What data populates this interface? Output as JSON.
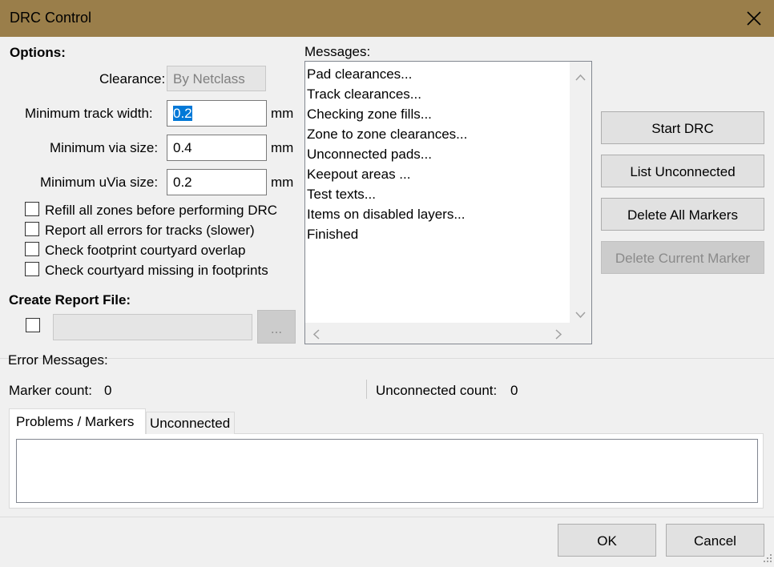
{
  "window": {
    "title": "DRC Control"
  },
  "options": {
    "heading": "Options:",
    "clearance": {
      "label": "Clearance:",
      "value": "By Netclass"
    },
    "min_track": {
      "label": "Minimum track width:",
      "value": "0.2",
      "unit": "mm"
    },
    "min_via": {
      "label": "Minimum via size:",
      "value": "0.4",
      "unit": "mm"
    },
    "min_uvia": {
      "label": "Minimum uVia size:",
      "value": "0.2",
      "unit": "mm"
    },
    "checkboxes": [
      {
        "label": "Refill all zones before performing DRC",
        "checked": false
      },
      {
        "label": "Report all errors for tracks (slower)",
        "checked": false
      },
      {
        "label": "Check footprint courtyard overlap",
        "checked": false
      },
      {
        "label": "Check courtyard missing in footprints",
        "checked": false
      }
    ]
  },
  "report": {
    "heading": "Create Report File:",
    "checked": false,
    "path": "",
    "browse_label": "..."
  },
  "messages": {
    "label": "Messages:",
    "lines": [
      "Pad clearances...",
      "Track clearances...",
      "Checking zone fills...",
      "Zone to zone clearances...",
      "Unconnected pads...",
      "Keepout areas ...",
      "Test texts...",
      "Items on disabled layers...",
      "Finished"
    ]
  },
  "actions": {
    "start_drc": "Start DRC",
    "list_unconnected": "List Unconnected",
    "delete_all_markers": "Delete All Markers",
    "delete_current_marker": "Delete Current Marker"
  },
  "errors": {
    "label": "Error Messages:",
    "marker_count_label": "Marker count:",
    "marker_count": "0",
    "unconnected_count_label": "Unconnected count:",
    "unconnected_count": "0",
    "tabs": [
      "Problems / Markers",
      "Unconnected"
    ],
    "active_tab": "Problems / Markers"
  },
  "footer": {
    "ok": "OK",
    "cancel": "Cancel"
  },
  "icons": {
    "close": "close-icon",
    "scroll_up": "chevron-up-icon",
    "scroll_down": "chevron-down-icon",
    "scroll_left": "chevron-left-icon",
    "scroll_right": "chevron-right-icon",
    "resize": "resize-grip-icon"
  },
  "colors": {
    "titlebar": "#9a7e4a",
    "selection": "#0078d7"
  }
}
